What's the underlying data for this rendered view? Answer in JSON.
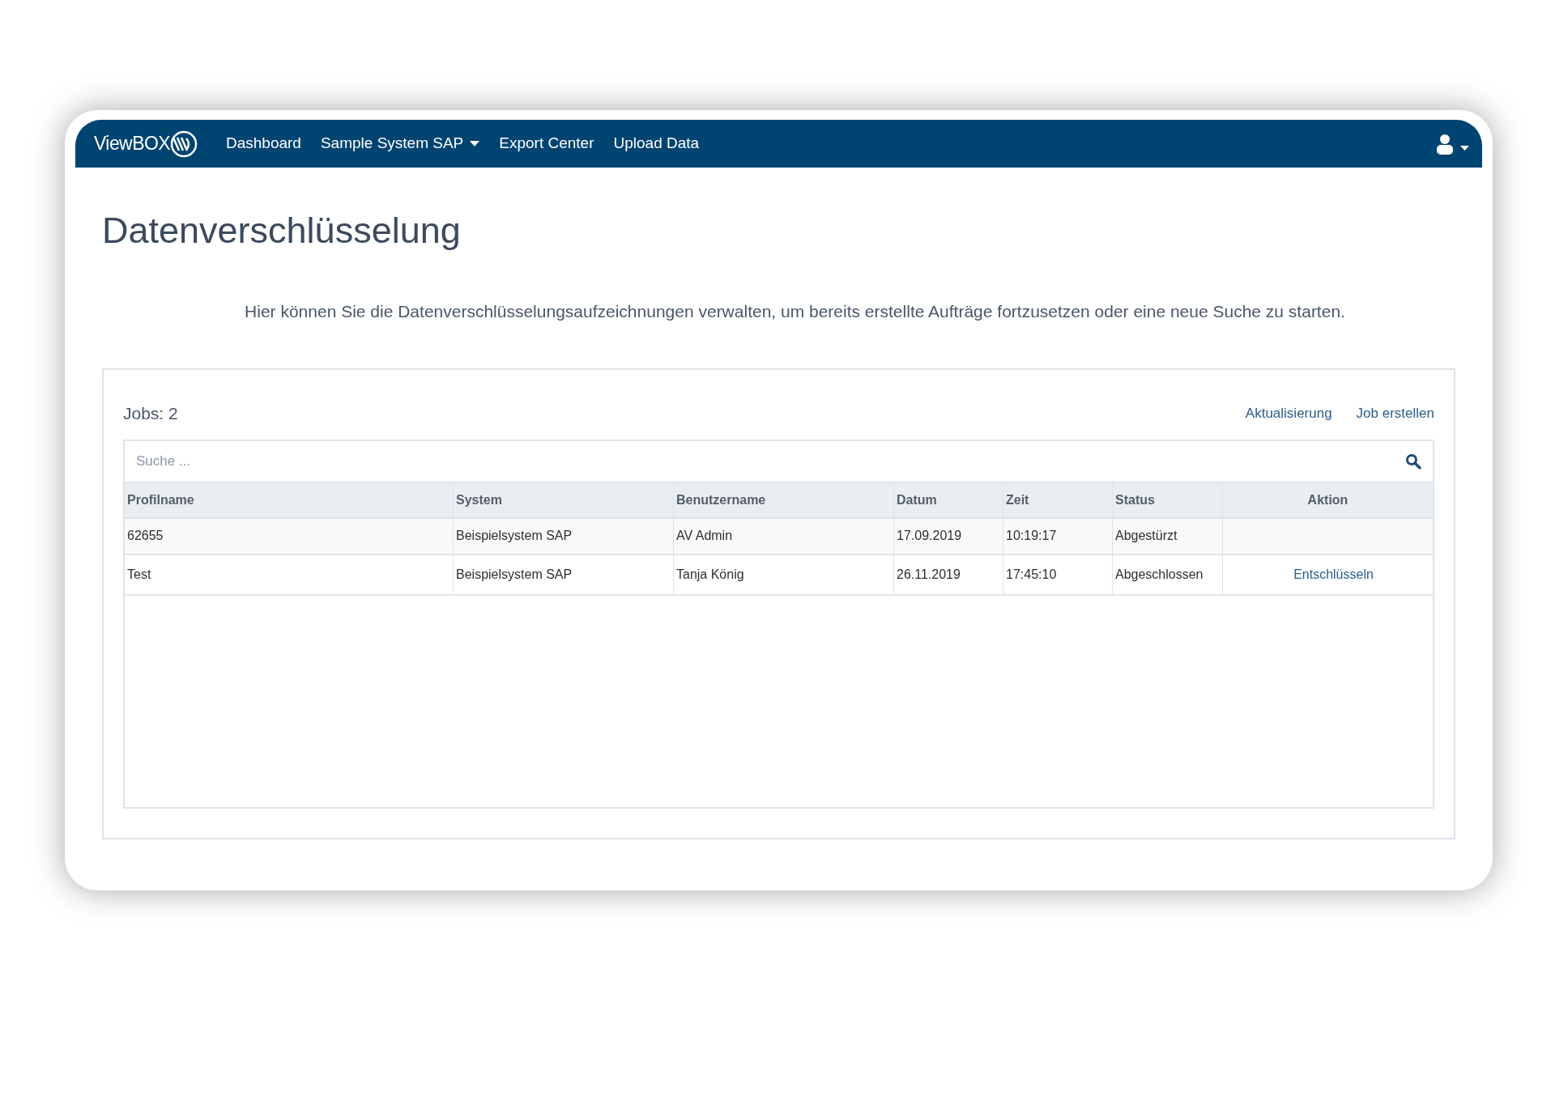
{
  "navbar": {
    "logo": "ViewBOX",
    "items": [
      {
        "label": "Dashboard",
        "dropdown": false
      },
      {
        "label": "Sample System SAP",
        "dropdown": true
      },
      {
        "label": "Export Center",
        "dropdown": false
      },
      {
        "label": "Upload Data",
        "dropdown": false
      }
    ]
  },
  "page": {
    "title": "Datenverschlüsselung",
    "description": "Hier können Sie die Datenverschlüsselungsaufzeichnungen verwalten, um bereits erstellte Aufträge fortzusetzen oder eine neue Suche zu starten."
  },
  "panel": {
    "count": "Jobs: 2",
    "actions": [
      "Aktualisierung",
      "Job erstellen"
    ],
    "search": {
      "placeholder": "Suche ..."
    }
  },
  "table": {
    "columns": [
      "Profilname",
      "System",
      "Benutzername",
      "Datum",
      "Zeit",
      "Status",
      "Aktion"
    ],
    "rows": [
      {
        "cells": [
          "62655",
          "Beispielsystem SAP",
          "AV Admin",
          "17.09.2019",
          "10:19:17",
          "Abgestürzt"
        ]
      },
      {
        "cells": [
          "Test",
          "Beispielsystem SAP",
          "Tanja König",
          "26.11.2019",
          "17:45:10",
          "Abgeschlossen"
        ],
        "action": "Entschlüsseln"
      }
    ]
  }
}
